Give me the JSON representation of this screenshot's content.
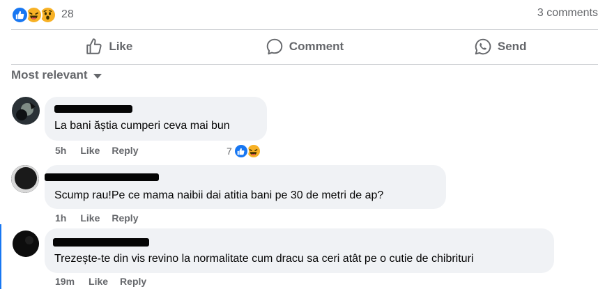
{
  "post": {
    "reaction_icons": [
      "like-icon",
      "haha-icon",
      "wow-icon"
    ],
    "reaction_count": "28",
    "comments_count": "3 comments"
  },
  "actions": {
    "like_label": "Like",
    "comment_label": "Comment",
    "send_label": "Send"
  },
  "sort_label": "Most relevant",
  "comments": [
    {
      "text": "La bani ăștia cumperi ceva mai bun",
      "time": "5h",
      "like_label": "Like",
      "reply_label": "Reply",
      "reaction_count": "7",
      "reaction_icons": [
        "like-icon",
        "haha-icon"
      ]
    },
    {
      "text": "Scump rau!Pe ce mama naibii dai atitia bani pe 30 de metri de ap?",
      "time": "1h",
      "like_label": "Like",
      "reply_label": "Reply"
    },
    {
      "text": "Trezește-te din vis revino la normalitate cum dracu sa ceri atât pe o cutie de chibrituri",
      "time": "19m",
      "like_label": "Like",
      "reply_label": "Reply"
    }
  ],
  "colors": {
    "accent": "#1877f2",
    "secondary_text": "#65676b",
    "bubble": "#f0f2f5"
  }
}
